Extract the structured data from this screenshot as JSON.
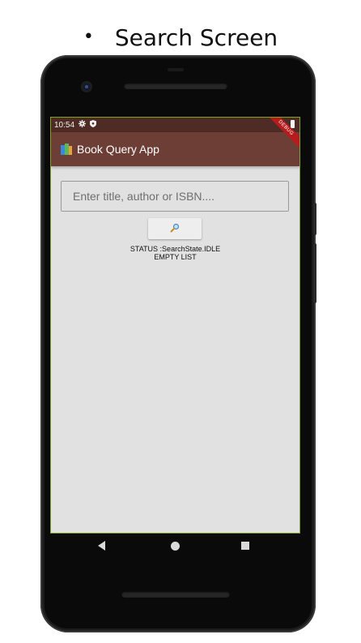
{
  "slide": {
    "bullet": "•",
    "heading": "Search Screen"
  },
  "statusbar": {
    "time": "10:54",
    "icons": [
      "gear-icon",
      "shield-icon",
      "battery-icon"
    ]
  },
  "appbar": {
    "title": "Book Query App",
    "icon": "books-icon",
    "debug_banner": "DEBUG"
  },
  "search": {
    "placeholder": "Enter title, author or ISBN....",
    "value": "",
    "button_icon": "search-icon"
  },
  "status": {
    "line1": "STATUS :SearchState.IDLE",
    "line2": "EMPTY LIST"
  },
  "navbar": {
    "buttons": [
      "back-icon",
      "home-icon",
      "recents-icon"
    ]
  },
  "colors": {
    "statusbar": "#4e2b24",
    "appbar": "#6d3e35",
    "screen_bg": "#e1e1e1",
    "debug": "#b71c1c"
  }
}
